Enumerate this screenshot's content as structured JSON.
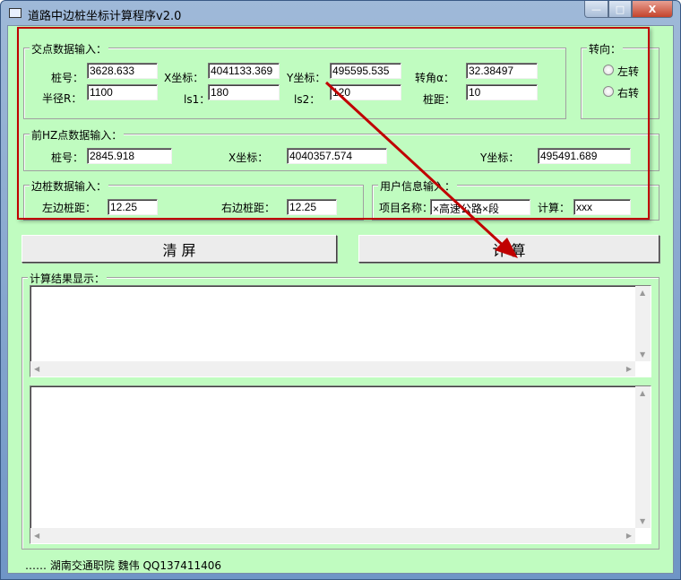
{
  "window": {
    "title": "道路中边桩坐标计算程序v2.0",
    "minimize": "—",
    "maximize": "□",
    "close": "X"
  },
  "jd": {
    "legend": "交点数据输入：",
    "fields": [
      {
        "label": "桩号：",
        "value": "3628.633"
      },
      {
        "label": "X坐标：",
        "value": "4041133.369"
      },
      {
        "label": "Y坐标：",
        "value": "495595.535"
      },
      {
        "label": "转角α：",
        "value": "32.38497"
      },
      {
        "label": "半径R：",
        "value": "1100"
      },
      {
        "label": "ls1：",
        "value": "180"
      },
      {
        "label": "ls2：",
        "value": "120"
      },
      {
        "label": "桩距：",
        "value": "10"
      }
    ]
  },
  "turn": {
    "legend": "转向：",
    "options": [
      "左转",
      "右转"
    ]
  },
  "hz": {
    "legend": "前HZ点数据输入：",
    "fields": [
      {
        "label": "桩号：",
        "value": "2845.918"
      },
      {
        "label": "X坐标：",
        "value": "4040357.574"
      },
      {
        "label": "Y坐标：",
        "value": "495491.689"
      }
    ]
  },
  "side": {
    "legend": "边桩数据输入：",
    "fields": [
      {
        "label": "左边桩距：",
        "value": "12.25"
      },
      {
        "label": "右边桩距：",
        "value": "12.25"
      }
    ]
  },
  "user": {
    "legend": "用户信息输入：",
    "fields": [
      {
        "label": "项目名称：",
        "value": "×高速公路×段"
      },
      {
        "label": "计算：",
        "value": "xxx"
      }
    ]
  },
  "buttons": {
    "clear": "清          屏",
    "calc": "计          算"
  },
  "result": {
    "legend": "计算结果显示："
  },
  "footer": "…… 湖南交通职院 魏伟 QQ137411406",
  "colors": {
    "bg": "#c0fcc0",
    "annotation": "#c00000"
  }
}
